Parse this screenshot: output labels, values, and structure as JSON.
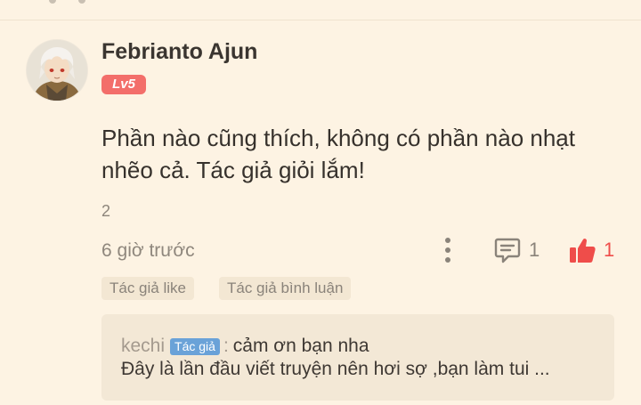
{
  "comment": {
    "avatar_icon": "anime-character-avatar",
    "username": "Febrianto Ajun",
    "level_badge": "Lv5",
    "text": "Phần nào cũng thích, không có phần nào nhạt nhẽo cả. Tác giả giỏi lắm!",
    "sub_count": "2",
    "timestamp": "6 giờ trước",
    "more_icon": "vertical-ellipsis-icon",
    "reply_icon": "comment-bubble-icon",
    "reply_count": "1",
    "like_icon": "thumbs-up-icon",
    "like_count": "1",
    "tags": [
      "Tác giả like",
      "Tác giả bình luận"
    ]
  },
  "author_reply": {
    "author": "kechi",
    "author_badge": "Tác giả",
    "separator": ":",
    "first_line": "cảm ơn bạn nha",
    "second_line": "Đây là lần đầu viết truyện nên hơi sợ ,bạn làm tui ..."
  },
  "colors": {
    "background": "#fdf3e3",
    "level_badge": "#f36e6a",
    "like": "#ef4d4a",
    "author_badge": "#6aa2d8",
    "reply_box": "#f3e8d6"
  }
}
